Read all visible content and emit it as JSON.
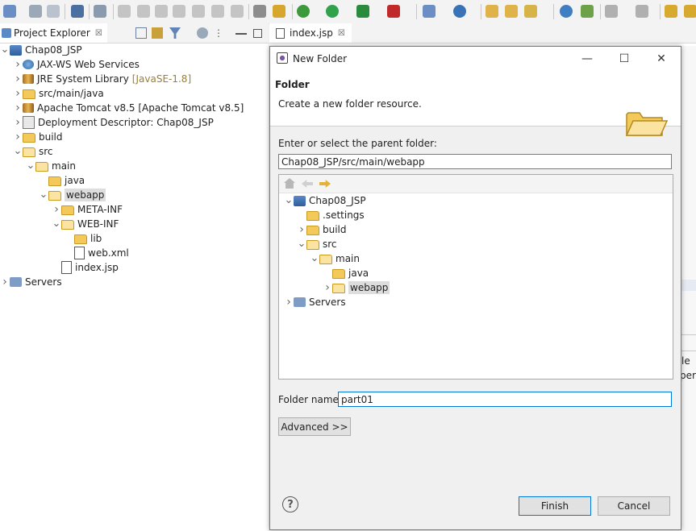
{
  "project_explorer": {
    "tab_label": "Project Explorer",
    "tab_close": "☒",
    "tree": [
      {
        "label": "Chap08_JSP",
        "icon": "project-icon",
        "depth": 0,
        "chevron": "v"
      },
      {
        "label": "JAX-WS Web Services",
        "icon": "webservice-icon",
        "depth": 1,
        "chevron": ">"
      },
      {
        "label": "JRE System Library",
        "suffix": "[JavaSE-1.8]",
        "icon": "library-icon",
        "depth": 1,
        "chevron": ">"
      },
      {
        "label": "src/main/java",
        "icon": "source-folder-icon",
        "depth": 1,
        "chevron": ">"
      },
      {
        "label": "Apache Tomcat v8.5 [Apache Tomcat v8.5]",
        "icon": "library-icon",
        "depth": 1,
        "chevron": ">"
      },
      {
        "label": "Deployment Descriptor: Chap08_JSP",
        "icon": "descriptor-icon",
        "depth": 1,
        "chevron": ">"
      },
      {
        "label": "build",
        "icon": "folder-icon",
        "depth": 1,
        "chevron": ">"
      },
      {
        "label": "src",
        "icon": "folder-open-icon",
        "depth": 1,
        "chevron": "v"
      },
      {
        "label": "main",
        "icon": "folder-open-icon",
        "depth": 2,
        "chevron": "v"
      },
      {
        "label": "java",
        "icon": "folder-icon",
        "depth": 3,
        "chevron": ""
      },
      {
        "label": "webapp",
        "icon": "folder-open-icon",
        "depth": 3,
        "chevron": "v",
        "selected": true
      },
      {
        "label": "META-INF",
        "icon": "folder-icon",
        "depth": 4,
        "chevron": ">"
      },
      {
        "label": "WEB-INF",
        "icon": "folder-open-icon",
        "depth": 4,
        "chevron": "v"
      },
      {
        "label": "lib",
        "icon": "folder-icon",
        "depth": 5,
        "chevron": ""
      },
      {
        "label": "web.xml",
        "icon": "xml-file-icon",
        "depth": 5,
        "chevron": ""
      },
      {
        "label": "index.jsp",
        "icon": "jsp-file-icon",
        "depth": 4,
        "chevron": ""
      },
      {
        "label": "Servers",
        "icon": "servers-icon",
        "depth": 0,
        "chevron": ">"
      }
    ]
  },
  "editor": {
    "tab_label": "index.jsp",
    "tab_close": "☒",
    "right_fragments": [
      "le",
      "per"
    ]
  },
  "dialog": {
    "title": "New Folder",
    "minimize": "—",
    "maximize": "☐",
    "close": "✕",
    "heading": "Folder",
    "description": "Create a new folder resource.",
    "parent_label": "Enter or select the parent folder:",
    "parent_value": "Chap08_JSP/src/main/webapp",
    "tree": [
      {
        "label": "Chap08_JSP",
        "icon": "project-icon",
        "depth": 0,
        "chevron": "v"
      },
      {
        "label": ".settings",
        "icon": "folder-icon",
        "depth": 1,
        "chevron": ""
      },
      {
        "label": "build",
        "icon": "folder-icon",
        "depth": 1,
        "chevron": ">"
      },
      {
        "label": "src",
        "icon": "folder-open-icon",
        "depth": 1,
        "chevron": "v"
      },
      {
        "label": "main",
        "icon": "folder-open-icon",
        "depth": 2,
        "chevron": "v"
      },
      {
        "label": "java",
        "icon": "folder-icon",
        "depth": 3,
        "chevron": ""
      },
      {
        "label": "webapp",
        "icon": "folder-open-icon",
        "depth": 3,
        "chevron": ">",
        "selected": true
      },
      {
        "label": "Servers",
        "icon": "servers-icon",
        "depth": 0,
        "chevron": ">"
      }
    ],
    "folder_name_label": "Folder name:",
    "folder_name_value": "part01",
    "advanced_label": "Advanced >>",
    "help_label": "?",
    "finish_label": "Finish",
    "cancel_label": "Cancel"
  },
  "colors": {
    "selection": "#dddddd",
    "focus_border": "#0078d7",
    "folder": "#f3c95a"
  }
}
